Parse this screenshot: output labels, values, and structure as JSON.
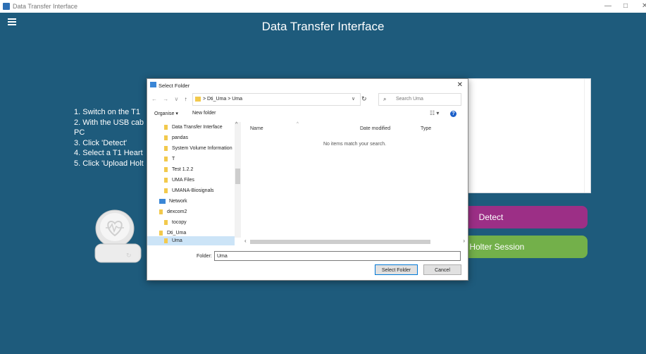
{
  "window": {
    "title": "Data Transfer Interface",
    "controls": {
      "minimize": "—",
      "maximize": "□",
      "close": "✕"
    }
  },
  "app": {
    "title": "Data Transfer Interface",
    "instructions": [
      "1. Switch on the T1",
      "2. With the USB cab",
      "PC",
      "3. Click 'Detect'",
      "4. Select a T1 Heart",
      "5. Click 'Upload Holt"
    ],
    "buttons": {
      "detect": "Detect",
      "upload": "ad Holter Session"
    },
    "colors": {
      "background": "#1e5b7c",
      "detect": "#9c2f86",
      "upload": "#73b04a"
    }
  },
  "dialog": {
    "title": "Select Folder",
    "close": "✕",
    "nav": {
      "back": "←",
      "forward": "→",
      "recent": "∨",
      "up": "↑",
      "breadcrumb": "> Dti_Uma > Uma",
      "dropdown": "∨",
      "refresh": "↻",
      "search_placeholder": "Search Uma"
    },
    "toolbar": {
      "organise": "Organise ▾",
      "new_folder": "New folder",
      "views": "☷ ▾",
      "help": "?"
    },
    "nav_pane": [
      {
        "label": "Data Transfer Interface",
        "icon": "folder-icon"
      },
      {
        "label": "pandas",
        "icon": "folder-icon"
      },
      {
        "label": "System Volume Information",
        "icon": "folder-icon"
      },
      {
        "label": "T",
        "icon": "folder-icon"
      },
      {
        "label": "Test 1.2.2",
        "icon": "folder-icon"
      },
      {
        "label": "UMA Files",
        "icon": "folder-icon"
      },
      {
        "label": "UMANA-Biosignals",
        "icon": "folder-icon"
      },
      {
        "label": "Network",
        "icon": "network-icon"
      },
      {
        "label": "dexcom2",
        "icon": "folder-icon"
      },
      {
        "label": "tocopy",
        "icon": "folder-icon"
      },
      {
        "label": "Dti_Uma",
        "icon": "folder-icon"
      },
      {
        "label": "Uma",
        "icon": "folder-icon",
        "selected": true
      }
    ],
    "columns": {
      "name": "Name",
      "date_modified": "Date modified",
      "type": "Type"
    },
    "empty_message": "No items match your search.",
    "folder_label": "Folder:",
    "folder_value": "Uma",
    "buttons": {
      "select": "Select Folder",
      "cancel": "Cancel"
    }
  }
}
